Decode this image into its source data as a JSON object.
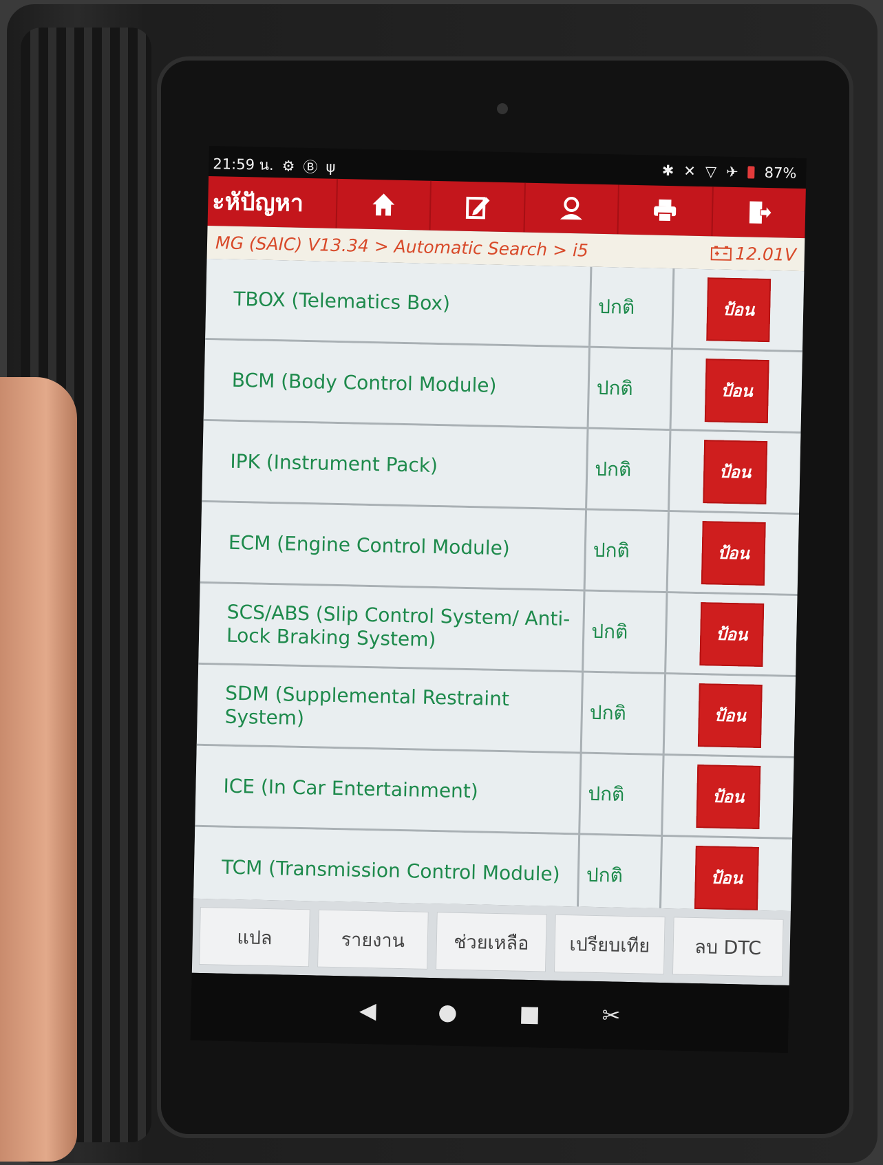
{
  "status_bar": {
    "time": "21:59 น.",
    "battery": "87%"
  },
  "toolbar": {
    "title": "ะหัปัญหา",
    "icons": [
      "home-icon",
      "edit-icon",
      "user-icon",
      "print-icon",
      "exit-icon"
    ]
  },
  "breadcrumb": {
    "path": "MG (SAIC) V13.34 > Automatic Search > i5",
    "voltage": "12.01V"
  },
  "systems": [
    {
      "name": "TBOX (Telematics Box)",
      "status": "ปกติ",
      "action": "ป้อน"
    },
    {
      "name": "BCM (Body Control Module)",
      "status": "ปกติ",
      "action": "ป้อน"
    },
    {
      "name": "IPK (Instrument Pack)",
      "status": "ปกติ",
      "action": "ป้อน"
    },
    {
      "name": "ECM (Engine Control Module)",
      "status": "ปกติ",
      "action": "ป้อน"
    },
    {
      "name": "SCS/ABS (Slip Control System/ Anti-Lock Braking System)",
      "status": "ปกติ",
      "action": "ป้อน"
    },
    {
      "name": "SDM (Supplemental Restraint System)",
      "status": "ปกติ",
      "action": "ป้อน"
    },
    {
      "name": "ICE (In Car Entertainment)",
      "status": "ปกติ",
      "action": "ป้อน"
    },
    {
      "name": "TCM (Transmission Control Module)",
      "status": "ปกติ",
      "action": "ป้อน"
    }
  ],
  "bottom_buttons": [
    "แปล",
    "รายงาน",
    "ช่วยเหลือ",
    "เปรียบเทีย",
    "ลบ DTC"
  ],
  "colors": {
    "toolbar": "#c4161c",
    "system_text": "#1e8a4c",
    "breadcrumb_text": "#d84a2a",
    "enter_button": "#cf1e1e"
  }
}
